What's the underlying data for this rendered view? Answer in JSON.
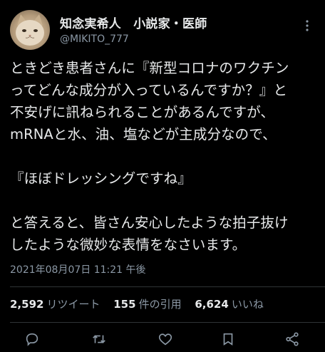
{
  "user": {
    "display_name": "知念実希人　小説家・医師",
    "handle": "@MIKITO_777"
  },
  "tweet": {
    "text": "ときどき患者さんに『新型コロナのワクチン\nってどんな成分が入っているんですか？』と\n不安げに訊ねられることがあるんですが、\nmRNAと水、油、塩などが主成分なので、\n\n『ほぼドレッシングですね』\n\nと答えると、皆さん安心したような拍子抜け\nしたような微妙な表情をなさいます。",
    "timestamp": "2021年08月07日 11:21 午後"
  },
  "stats": {
    "retweets": {
      "count": "2,592",
      "label": "リツイート"
    },
    "quotes": {
      "count": "155",
      "label": "件の引用"
    },
    "likes": {
      "count": "6,624",
      "label": "いいね"
    }
  },
  "icons": {
    "more": "more-vertical-icon",
    "reply": "reply-icon",
    "retweet": "retweet-icon",
    "like": "like-icon",
    "bookmark": "bookmark-icon",
    "share": "share-icon"
  },
  "colors": {
    "background": "#000000",
    "text": "#e7e9ea",
    "secondary": "#8b98a5",
    "divider": "#2f3336"
  }
}
